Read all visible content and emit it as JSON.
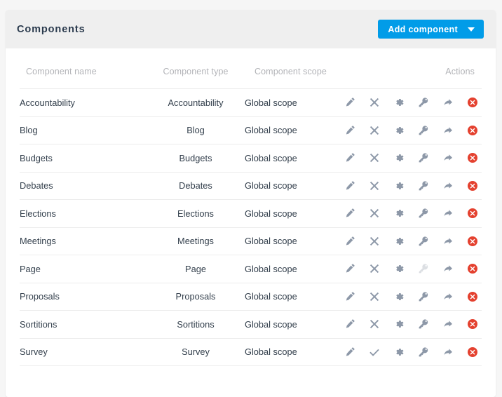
{
  "card": {
    "title": "Components",
    "add_button": {
      "label": "Add component",
      "icon": "chevron-down-icon",
      "color": "#019ce8"
    }
  },
  "table": {
    "columns": [
      "Component name",
      "Component type",
      "Component scope",
      "Actions"
    ],
    "rows": [
      {
        "name": "Accountability",
        "type": "Accountability",
        "scope": "Global scope",
        "actions": [
          "edit",
          "unpublish",
          "configure",
          "permissions",
          "share",
          "delete"
        ],
        "publish_state": "published",
        "permissions_enabled": true
      },
      {
        "name": "Blog",
        "type": "Blog",
        "scope": "Global scope",
        "actions": [
          "edit",
          "unpublish",
          "configure",
          "permissions",
          "share",
          "delete"
        ],
        "publish_state": "published",
        "permissions_enabled": true
      },
      {
        "name": "Budgets",
        "type": "Budgets",
        "scope": "Global scope",
        "actions": [
          "edit",
          "unpublish",
          "configure",
          "permissions",
          "share",
          "delete"
        ],
        "publish_state": "published",
        "permissions_enabled": true
      },
      {
        "name": "Debates",
        "type": "Debates",
        "scope": "Global scope",
        "actions": [
          "edit",
          "unpublish",
          "configure",
          "permissions",
          "share",
          "delete"
        ],
        "publish_state": "published",
        "permissions_enabled": true
      },
      {
        "name": "Elections",
        "type": "Elections",
        "scope": "Global scope",
        "actions": [
          "edit",
          "unpublish",
          "configure",
          "permissions",
          "share",
          "delete"
        ],
        "publish_state": "published",
        "permissions_enabled": true
      },
      {
        "name": "Meetings",
        "type": "Meetings",
        "scope": "Global scope",
        "actions": [
          "edit",
          "unpublish",
          "configure",
          "permissions",
          "share",
          "delete"
        ],
        "publish_state": "published",
        "permissions_enabled": true
      },
      {
        "name": "Page",
        "type": "Page",
        "scope": "Global scope",
        "actions": [
          "edit",
          "unpublish",
          "configure",
          "permissions",
          "share",
          "delete"
        ],
        "publish_state": "published",
        "permissions_enabled": false
      },
      {
        "name": "Proposals",
        "type": "Proposals",
        "scope": "Global scope",
        "actions": [
          "edit",
          "unpublish",
          "configure",
          "permissions",
          "share",
          "delete"
        ],
        "publish_state": "published",
        "permissions_enabled": true
      },
      {
        "name": "Sortitions",
        "type": "Sortitions",
        "scope": "Global scope",
        "actions": [
          "edit",
          "unpublish",
          "configure",
          "permissions",
          "share",
          "delete"
        ],
        "publish_state": "published",
        "permissions_enabled": true
      },
      {
        "name": "Survey",
        "type": "Survey",
        "scope": "Global scope",
        "actions": [
          "edit",
          "publish",
          "configure",
          "permissions",
          "share",
          "delete"
        ],
        "publish_state": "unpublished",
        "permissions_enabled": true
      }
    ]
  },
  "icons": {
    "edit": "pencil-icon",
    "unpublish": "close-x-icon",
    "publish": "check-icon",
    "configure": "gear-icon",
    "permissions": "key-icon",
    "share": "arrow-share-icon",
    "delete": "delete-circle-icon"
  },
  "colors": {
    "icon_default": "#8d98a8",
    "icon_disabled": "#dcdfe3",
    "delete": "#e4412f",
    "accent": "#019ce8",
    "header_bg": "#efefef",
    "text": "#34404d",
    "muted": "#b3b4b8"
  }
}
